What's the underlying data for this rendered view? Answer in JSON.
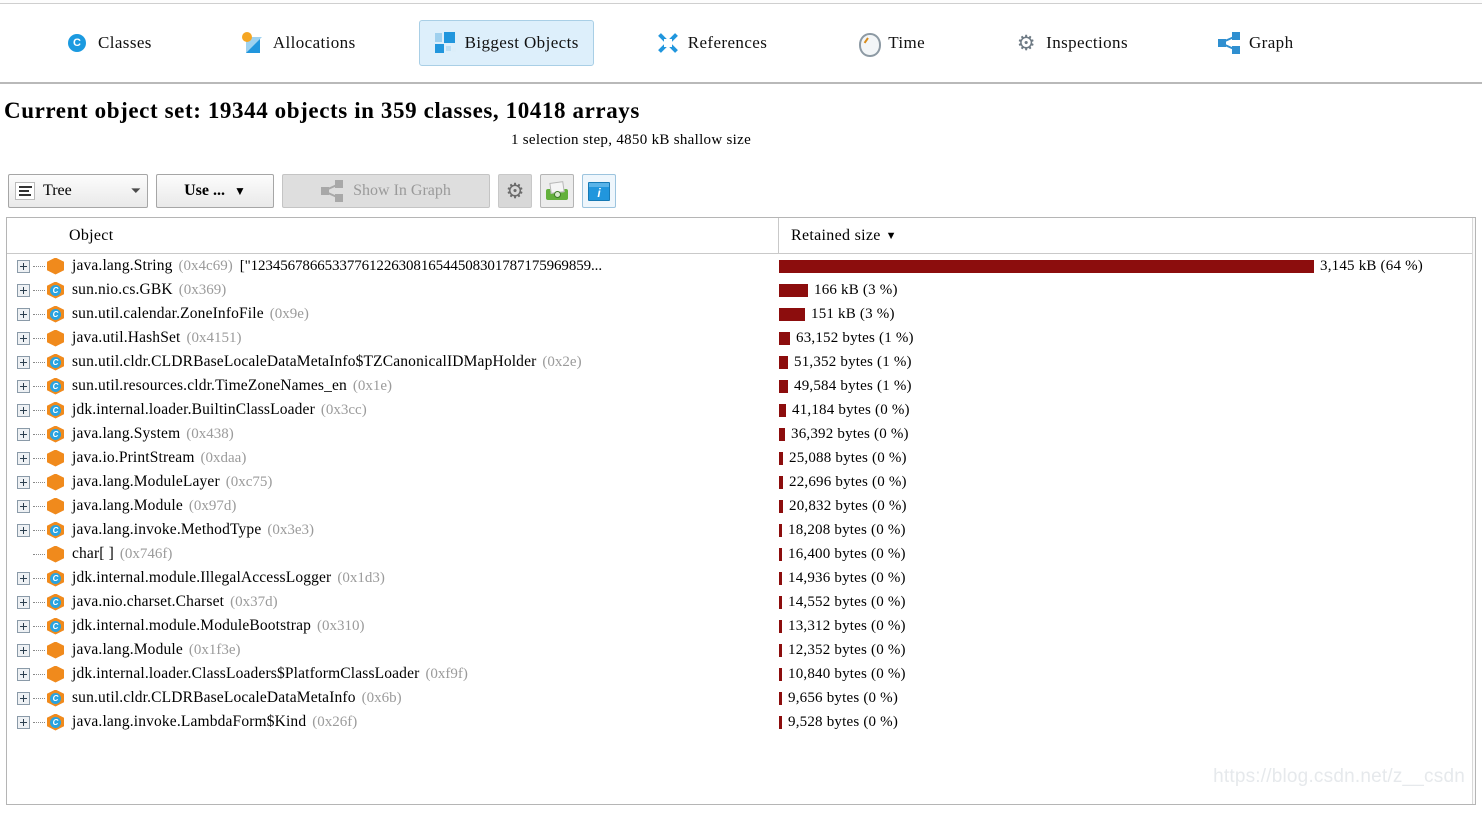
{
  "tabs": [
    {
      "label": "Classes",
      "icon": "classes-icon",
      "active": false
    },
    {
      "label": "Allocations",
      "icon": "allocations-icon",
      "active": false
    },
    {
      "label": "Biggest Objects",
      "icon": "biggest-objects-icon",
      "active": true
    },
    {
      "label": "References",
      "icon": "references-icon",
      "active": false
    },
    {
      "label": "Time",
      "icon": "clock-icon",
      "active": false
    },
    {
      "label": "Inspections",
      "icon": "gear-icon",
      "active": false
    },
    {
      "label": "Graph",
      "icon": "graph-icon",
      "active": false
    }
  ],
  "header": {
    "title": "Current object set: 19344 objects in 359 classes, 10418 arrays",
    "subtitle": "1 selection step, 4850 kB shallow size"
  },
  "toolbar": {
    "view_select": "Tree",
    "use_button": "Use ...",
    "show_in_graph": "Show In Graph",
    "settings_icon": "gear-icon",
    "snapshot_icon": "camera-icon",
    "info_icon": "info-window-icon"
  },
  "table": {
    "columns": {
      "object": "Object",
      "retained": "Retained size"
    },
    "sort_indicator": "▼",
    "rows": [
      {
        "name": "java.lang.String",
        "addr": "(0x4c69)",
        "value": "[\"1234567866533776122630816544508301787175969859...",
        "kind": "instance",
        "expandable": true,
        "retained": "3,145 kB  (64 %)",
        "bar_pct": 100
      },
      {
        "name": "sun.nio.cs.GBK",
        "addr": "(0x369)",
        "value": "",
        "kind": "class",
        "expandable": true,
        "retained": "166 kB  (3 %)",
        "bar_pct": 5.4
      },
      {
        "name": "sun.util.calendar.ZoneInfoFile",
        "addr": "(0x9e)",
        "value": "",
        "kind": "class",
        "expandable": true,
        "retained": "151 kB  (3 %)",
        "bar_pct": 4.9
      },
      {
        "name": "java.util.HashSet",
        "addr": "(0x4151)",
        "value": "",
        "kind": "instance",
        "expandable": true,
        "retained": "63,152 bytes  (1 %)",
        "bar_pct": 2.0
      },
      {
        "name": "sun.util.cldr.CLDRBaseLocaleDataMetaInfo$TZCanonicalIDMapHolder",
        "addr": "(0x2e)",
        "value": "",
        "kind": "class",
        "expandable": true,
        "retained": "51,352 bytes  (1 %)",
        "bar_pct": 1.7
      },
      {
        "name": "sun.util.resources.cldr.TimeZoneNames_en",
        "addr": "(0x1e)",
        "value": "",
        "kind": "class",
        "expandable": true,
        "retained": "49,584 bytes  (1 %)",
        "bar_pct": 1.6
      },
      {
        "name": "jdk.internal.loader.BuiltinClassLoader",
        "addr": "(0x3cc)",
        "value": "",
        "kind": "class",
        "expandable": true,
        "retained": "41,184 bytes  (0 %)",
        "bar_pct": 1.35
      },
      {
        "name": "java.lang.System",
        "addr": "(0x438)",
        "value": "",
        "kind": "class",
        "expandable": true,
        "retained": "36,392 bytes  (0 %)",
        "bar_pct": 1.2
      },
      {
        "name": "java.io.PrintStream",
        "addr": "(0xdaa)",
        "value": "",
        "kind": "instance",
        "expandable": true,
        "retained": "25,088 bytes  (0 %)",
        "bar_pct": 0.83
      },
      {
        "name": "java.lang.ModuleLayer",
        "addr": "(0xc75)",
        "value": "",
        "kind": "instance",
        "expandable": true,
        "retained": "22,696 bytes  (0 %)",
        "bar_pct": 0.75
      },
      {
        "name": "java.lang.Module",
        "addr": "(0x97d)",
        "value": "",
        "kind": "instance",
        "expandable": true,
        "retained": "20,832 bytes  (0 %)",
        "bar_pct": 0.69
      },
      {
        "name": "java.lang.invoke.MethodType",
        "addr": "(0x3e3)",
        "value": "",
        "kind": "class",
        "expandable": true,
        "retained": "18,208 bytes  (0 %)",
        "bar_pct": 0.6
      },
      {
        "name": "char[ ]",
        "addr": "(0x746f)",
        "value": "",
        "kind": "instance",
        "expandable": false,
        "retained": "16,400 bytes  (0 %)",
        "bar_pct": 0.54
      },
      {
        "name": "jdk.internal.module.IllegalAccessLogger",
        "addr": "(0x1d3)",
        "value": "",
        "kind": "class",
        "expandable": true,
        "retained": "14,936 bytes  (0 %)",
        "bar_pct": 0.49
      },
      {
        "name": "java.nio.charset.Charset",
        "addr": "(0x37d)",
        "value": "",
        "kind": "class",
        "expandable": true,
        "retained": "14,552 bytes  (0 %)",
        "bar_pct": 0.48
      },
      {
        "name": "jdk.internal.module.ModuleBootstrap",
        "addr": "(0x310)",
        "value": "",
        "kind": "class",
        "expandable": true,
        "retained": "13,312 bytes  (0 %)",
        "bar_pct": 0.44
      },
      {
        "name": "java.lang.Module",
        "addr": "(0x1f3e)",
        "value": "",
        "kind": "instance",
        "expandable": true,
        "retained": "12,352 bytes  (0 %)",
        "bar_pct": 0.41
      },
      {
        "name": "jdk.internal.loader.ClassLoaders$PlatformClassLoader",
        "addr": "(0xf9f)",
        "value": "",
        "kind": "instance",
        "expandable": true,
        "retained": "10,840 bytes  (0 %)",
        "bar_pct": 0.36
      },
      {
        "name": "sun.util.cldr.CLDRBaseLocaleDataMetaInfo",
        "addr": "(0x6b)",
        "value": "",
        "kind": "class",
        "expandable": true,
        "retained": "9,656 bytes  (0 %)",
        "bar_pct": 0.32
      },
      {
        "name": "java.lang.invoke.LambdaForm$Kind",
        "addr": "(0x26f)",
        "value": "",
        "kind": "class",
        "expandable": true,
        "retained": "9,528 bytes  (0 %)",
        "bar_pct": 0.31
      }
    ]
  },
  "watermark": "https://blog.csdn.net/z__csdn",
  "colors": {
    "bar": "#8c0d0d",
    "accent": "#2196dd",
    "instance": "#f08a1c",
    "active_tab_bg": "#ddeffb"
  }
}
